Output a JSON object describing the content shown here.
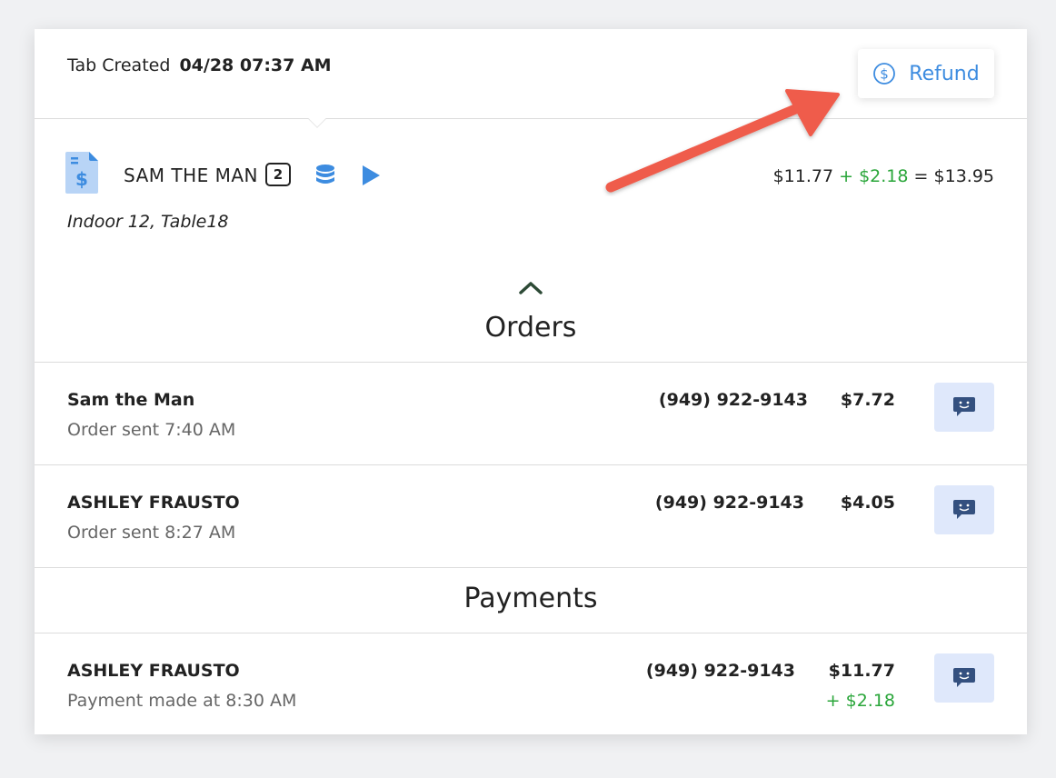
{
  "header": {
    "tab_created_label": "Tab Created",
    "tab_created_value": "04/28 07:37 AM",
    "refund_label": "Refund"
  },
  "tab": {
    "customer_name": "SAM THE MAN",
    "guest_count": "2",
    "location": "Indoor 12, Table18",
    "totals": {
      "subtotal": "$11.77",
      "plus": "+",
      "tip": "$2.18",
      "equals": "=",
      "total": "$13.95"
    }
  },
  "orders": {
    "title": "Orders",
    "items": [
      {
        "name": "Sam the Man",
        "status": "Order sent 7:40 AM",
        "phone": "(949) 922-9143",
        "amount": "$7.72"
      },
      {
        "name": "ASHLEY FRAUSTO",
        "status": "Order sent 8:27 AM",
        "phone": "(949) 922-9143",
        "amount": "$4.05"
      }
    ]
  },
  "payments": {
    "title": "Payments",
    "items": [
      {
        "name": "ASHLEY FRAUSTO",
        "status": "Payment made at 8:30 AM",
        "phone": "(949) 922-9143",
        "amount": "$11.77",
        "tip": "+ $2.18"
      }
    ]
  },
  "icons": {
    "refund": "dollar-circle-icon",
    "document": "receipt-document-icon",
    "database": "database-icon",
    "play": "play-icon",
    "collapse": "chevron-up-icon",
    "message": "chat-bubble-icon"
  },
  "colors": {
    "accent_blue": "#3d8ce0",
    "tip_green": "#2aa63a",
    "message_button_bg": "#dfe8fb",
    "annotation_arrow": "#ef5b4c"
  }
}
